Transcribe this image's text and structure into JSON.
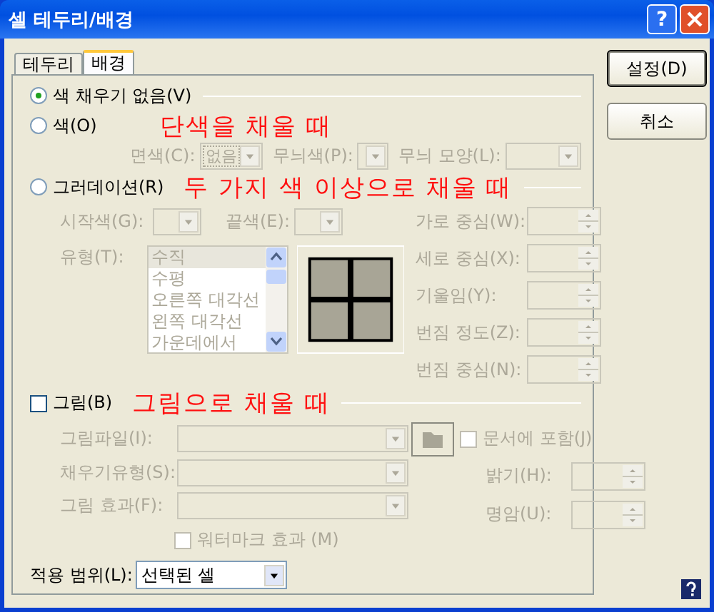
{
  "window": {
    "title": "셀 테두리/배경",
    "help": "?"
  },
  "tabs": [
    {
      "label": "테두리",
      "selected": false
    },
    {
      "label": "배경",
      "selected": true
    }
  ],
  "no_fill": {
    "label": "색 채우기 없음(V)",
    "selected": true
  },
  "solid": {
    "label": "색(O)",
    "selected": false,
    "disabled": true,
    "annotation": "단색을 채울 때",
    "face": {
      "label": "면색(C):",
      "value": "없음"
    },
    "pattern_color": {
      "label": "무늬색(P):"
    },
    "pattern": {
      "label": "무늬 모양(L):"
    }
  },
  "gradient": {
    "label": "그러데이션(R)",
    "selected": false,
    "disabled": true,
    "annotation": "두 가지 색 이상으로 채울 때",
    "start": {
      "label": "시작색(G):"
    },
    "end": {
      "label": "끝색(E):"
    },
    "type": {
      "label": "유형(T):",
      "options": [
        {
          "label": "수직",
          "selected": true
        },
        {
          "label": "수평",
          "selected": false
        },
        {
          "label": "오른쪽 대각선",
          "selected": false
        },
        {
          "label": "왼쪽 대각선",
          "selected": false
        },
        {
          "label": "가운데에서",
          "selected": false
        }
      ]
    },
    "spinners": [
      {
        "label": "가로 중심(W):"
      },
      {
        "label": "세로 중심(X):"
      },
      {
        "label": "기울임(Y):"
      },
      {
        "label": "번짐 정도(Z):"
      },
      {
        "label": "번짐 중심(N):"
      }
    ]
  },
  "picture": {
    "label": "그림(B)",
    "checked": false,
    "disabled": true,
    "annotation": "그림으로 채울 때",
    "file": {
      "label": "그림파일(I):"
    },
    "include": {
      "label": "문서에 포함(J)",
      "checked": false
    },
    "fill_type": {
      "label": "채우기유형(S):"
    },
    "effect": {
      "label": "그림 효과(F):"
    },
    "brightness": {
      "label": "밝기(H):"
    },
    "contrast": {
      "label": "명암(U):"
    },
    "watermark": {
      "label": "워터마크 효과 (M)",
      "checked": false
    }
  },
  "scope": {
    "label": "적용 범위(L):",
    "value": "선택된 셀"
  },
  "buttons": [
    {
      "label": "설정(D)",
      "default": true
    },
    {
      "label": "취소",
      "default": false
    }
  ]
}
